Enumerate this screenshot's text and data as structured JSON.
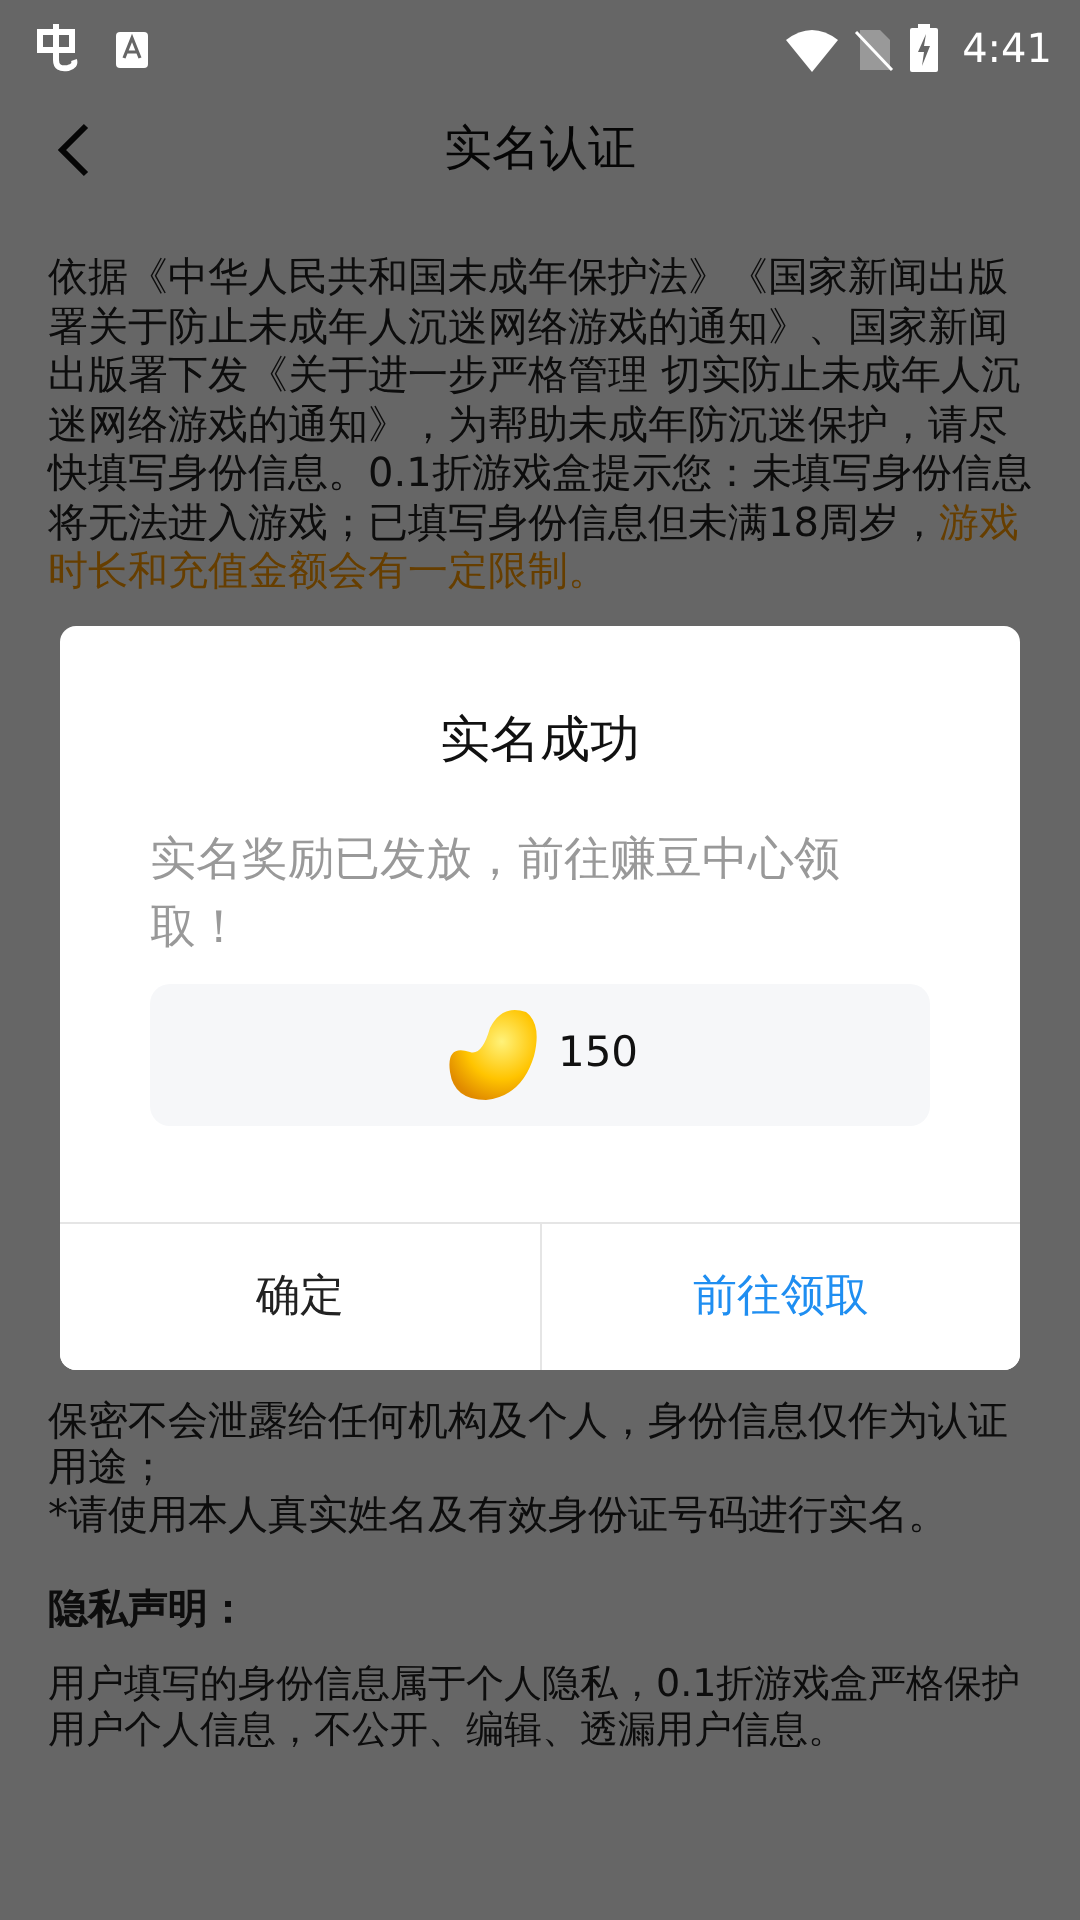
{
  "status_bar": {
    "time": "4:41"
  },
  "header": {
    "title": "实名认证"
  },
  "notice": {
    "text": "依据《中华人民共和国未成年保护法》《国家新闻出版署关于防止未成年人沉迷网络游戏的通知》、国家新闻出版署下发《关于进一步严格管理 切实防止未成年人沉迷网络游戏的通知》，为帮助未成年防沉迷保护，请尽快填写身份信息。0.1折游戏盒提示您：未填写身份信息将无法进入游戏；已填写身份信息但未满18周岁，",
    "highlight": "游戏时长和充值金额会有一定限制。"
  },
  "notes": [
    "保密不会泄露给任何机构及个人，身份信息仅作为认证用途；",
    "*请使用本人真实姓名及有效身份证号码进行实名。"
  ],
  "privacy": {
    "heading": "隐私声明：",
    "text": "用户填写的身份信息属于个人隐私，0.1折游戏盒严格保护用户个人信息，不公开、编辑、透漏用户信息。"
  },
  "dialog": {
    "title": "实名成功",
    "message": "实名奖励已发放，前往赚豆中心领取！",
    "reward": {
      "amount": "150"
    },
    "buttons": [
      {
        "label": "确定",
        "kind": "default"
      },
      {
        "label": "前往领取",
        "kind": "primary"
      }
    ]
  }
}
